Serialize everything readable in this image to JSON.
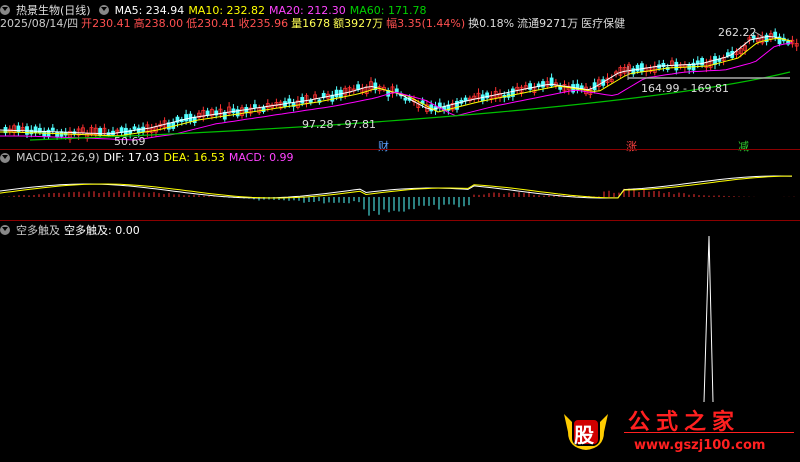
{
  "header": {
    "title": "热景生物(日线)",
    "ma5": "MA5: 234.94",
    "ma10": "MA10: 232.82",
    "ma20": "MA20: 212.30",
    "ma60": "MA60: 171.78"
  },
  "info": {
    "date": "2025/08/14/四",
    "open": "开230.41",
    "high": "高238.00",
    "low": "低230.41",
    "close": "收235.96",
    "vol": "量1678",
    "amount": "额3927万",
    "change": "幅3.35(1.44%)",
    "turnover": "换0.18%",
    "float": "流通9271万",
    "sector": "医疗保健"
  },
  "price_labels": {
    "hi": "262.22",
    "mid": "164.99 - 169.81",
    "mid2": "97.28 - 97.81",
    "lo": "50.69"
  },
  "markers": {
    "m1": "财",
    "m2": "涨",
    "m3": "减"
  },
  "macd": {
    "name": "MACD(12,26,9)",
    "dif": "DIF: 17.03",
    "dea": "DEA: 16.53",
    "macd": "MACD: 0.99"
  },
  "ind3": {
    "name": "空多触及",
    "value": "空多触及: 0.00"
  },
  "watermark": {
    "logo": "股",
    "site_cn": "公式之家",
    "site_url": "www.gszj100.com"
  },
  "colors": {
    "up": "#ff3232",
    "down": "#54ffff",
    "ma5": "#ffffff",
    "ma10": "#ffff00",
    "ma20": "#ff00ff",
    "ma60": "#00c000",
    "border": "#8b0000"
  }
}
